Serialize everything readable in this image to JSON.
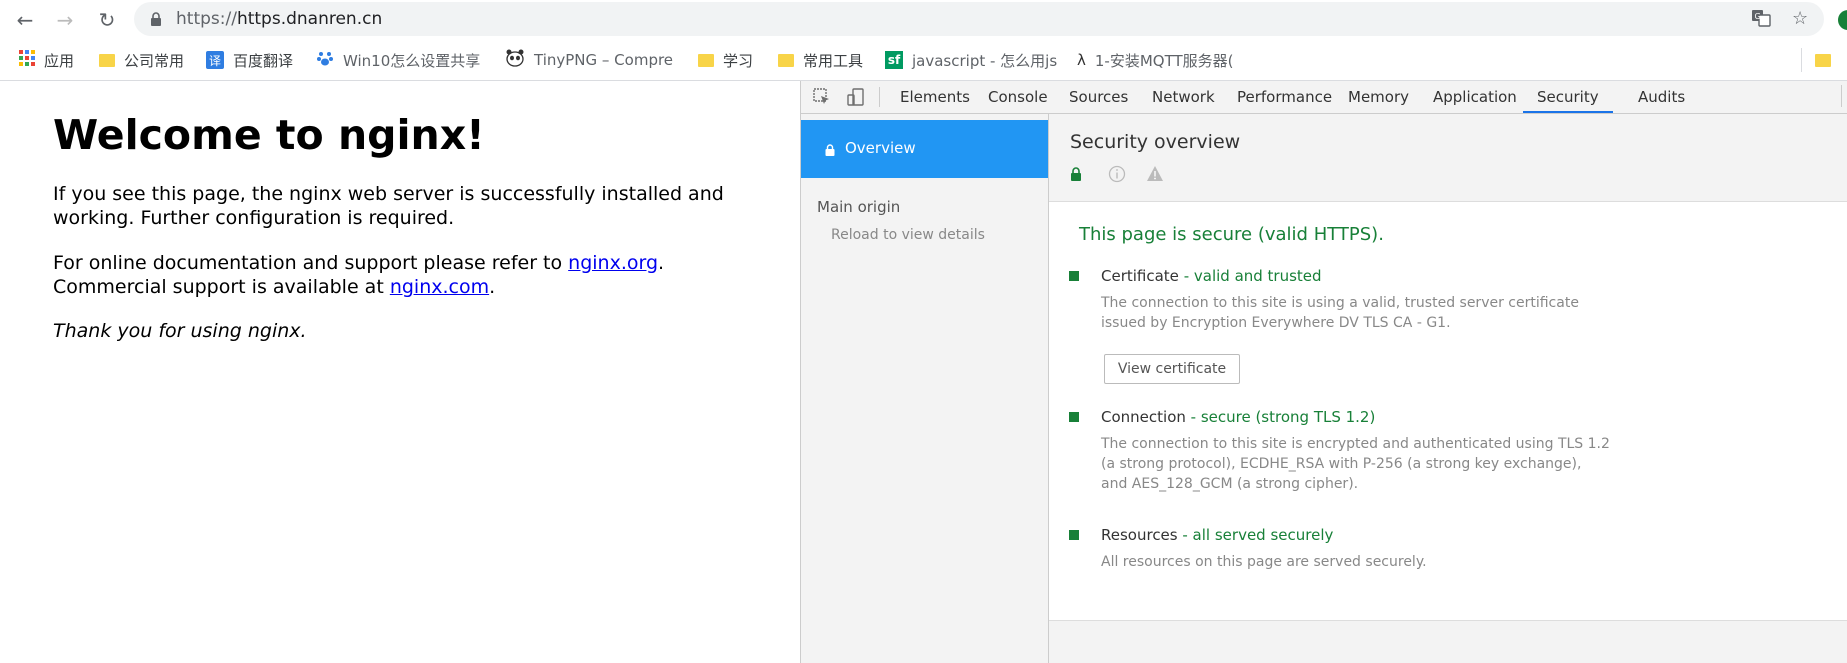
{
  "browser": {
    "url_scheme": "https://",
    "url_host": "https.dnanren.cn",
    "back_glyph": "←",
    "forward_glyph": "→",
    "reload_glyph": "↻",
    "star_glyph": "☆"
  },
  "bookmarks": [
    {
      "label": "应用"
    },
    {
      "label": "公司常用"
    },
    {
      "label": "百度翻译"
    },
    {
      "label": "Win10怎么设置共享"
    },
    {
      "label": "TinyPNG – Compre"
    },
    {
      "label": "学习"
    },
    {
      "label": "常用工具"
    },
    {
      "label": "javascript - 怎么用js"
    },
    {
      "label": "1-安装MQTT服务器("
    }
  ],
  "page": {
    "heading": "Welcome to nginx!",
    "para1": "If you see this page, the nginx web server is successfully installed and working. Further configuration is required.",
    "para2_a": "For online documentation and support please refer to ",
    "link1": "nginx.org",
    "para2_b": ".",
    "para2_c": "Commercial support is available at ",
    "link2": "nginx.com",
    "para2_d": ".",
    "thanks": "Thank you for using nginx."
  },
  "devtools": {
    "tabs": [
      "Elements",
      "Console",
      "Sources",
      "Network",
      "Performance",
      "Memory",
      "Application",
      "Security",
      "Audits"
    ],
    "active_tab": "Security",
    "sidebar": {
      "overview": "Overview",
      "main_origin": "Main origin",
      "reload": "Reload to view details"
    },
    "main": {
      "title": "Security overview",
      "secure_msg": "This page is secure (valid HTTPS).",
      "cert_label": "Certificate",
      "cert_status": " - valid and trusted",
      "cert_desc": "The connection to this site is using a valid, trusted server certificate issued by Encryption Everywhere DV TLS CA - G1.",
      "view_cert": "View certificate",
      "conn_label": "Connection",
      "conn_status": " - secure (strong TLS 1.2)",
      "conn_desc": "The connection to this site is encrypted and authenticated using TLS 1.2 (a strong protocol), ECDHE_RSA with P-256 (a strong key exchange), and AES_128_GCM (a strong cipher).",
      "res_label": "Resources",
      "res_status": " - all served securely",
      "res_desc": "All resources on this page are served securely."
    }
  },
  "colors": {
    "secure_green": "#188038",
    "active_blue": "#2196f3"
  }
}
